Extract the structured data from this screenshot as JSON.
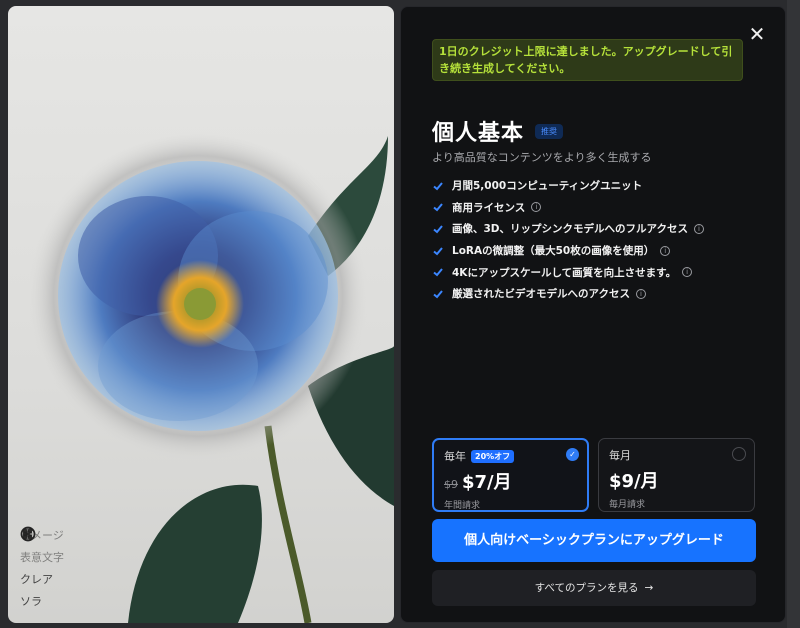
{
  "image": {
    "models": [
      {
        "name": "イメージ",
        "icon": "image-model-icon"
      },
      {
        "name": "表意文字",
        "icon": "ideogram-icon"
      },
      {
        "name": "クレア",
        "icon": "krea-icon"
      },
      {
        "name": "ソラ",
        "icon": "sora-icon"
      }
    ]
  },
  "modal": {
    "close": "✕",
    "alert": "1日のクレジット上限に達しました。アップグレードして引き続き生成してください。",
    "title": "個人基本",
    "badge": "推奨",
    "subtitle": "より高品質なコンテンツをより多く生成する",
    "features": [
      {
        "text": "月間5,000コンピューティングユニット",
        "info": false
      },
      {
        "text": "商用ライセンス",
        "info": true
      },
      {
        "text": "画像、3D、リップシンクモデルへのフルアクセス",
        "info": true
      },
      {
        "text": "LoRAの微調整（最大50枚の画像を使用）",
        "info": true
      },
      {
        "text": "4Kにアップスケールして画質を向上させます。",
        "info": true
      },
      {
        "text": "厳選されたビデオモデルへのアクセス",
        "info": true
      }
    ],
    "plans": {
      "yearly": {
        "label": "毎年",
        "discount": "20%オフ",
        "old_price": "$9",
        "price": "$7/月",
        "billing": "年間請求",
        "selected": true
      },
      "monthly": {
        "label": "毎月",
        "price": "$9/月",
        "billing": "毎月請求",
        "selected": false
      }
    },
    "upgrade_button": "個人向けベーシックプランにアップグレード",
    "all_plans_button": "すべてのプランを見る",
    "all_plans_arrow": "→"
  },
  "colors": {
    "accent": "#1773ff",
    "alert_text": "#b6e23a",
    "alert_bg": "#2e3a18",
    "modal_bg": "#111214"
  }
}
